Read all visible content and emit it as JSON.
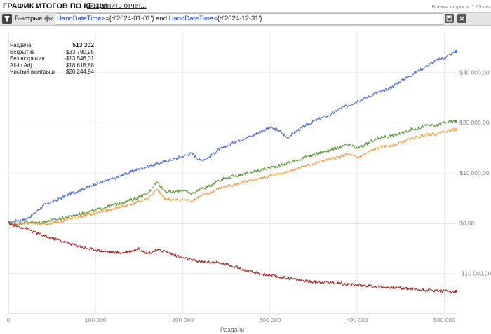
{
  "header": {
    "title": "ГРАФИК ИТОГОВ ПО КЕШУ",
    "save_link": "Сохранить отчет...",
    "request_time": "Время запроса: 1.05 сек"
  },
  "filter_bar": {
    "label": "Быстрые фильтры",
    "query": {
      "field1": "HandDateTime",
      "op1": ">={d'2024-01-01'} and ",
      "field2": "HandDateTime",
      "op2": "<{d'2024-12-31'}"
    },
    "icons": [
      "filter-icon",
      "save-icon",
      "close-icon"
    ]
  },
  "stats": [
    {
      "label": "Раздача:",
      "value": "513 302"
    },
    {
      "label": "Вскрытие",
      "value": "$33 790,95"
    },
    {
      "label": "Без вскрытия",
      "value": "-$13 546,01"
    },
    {
      "label": "All-in Adj",
      "value": "$18 618,88"
    },
    {
      "label": "Чистый выигрыш",
      "value": "$20 244,94"
    }
  ],
  "chart_data": {
    "type": "line",
    "xlabel": "Раздачи",
    "xlim": [
      0,
      513302
    ],
    "ylim": [
      -18000,
      38000
    ],
    "x_ticks": [
      0,
      100000,
      200000,
      300000,
      400000,
      500000
    ],
    "x_tick_labels": [
      "0",
      "100 000",
      "200 000",
      "300 000",
      "400 000",
      "500 000"
    ],
    "y_ticks": [
      -10000,
      0,
      10000,
      20000,
      30000
    ],
    "y_tick_labels": [
      "-$10 000,00",
      "$0,00",
      "$10 000,00",
      "$20 000,00",
      "$30 000,00"
    ],
    "grid": true,
    "x": [
      0,
      10000,
      20000,
      30000,
      40000,
      50000,
      60000,
      70000,
      80000,
      90000,
      100000,
      110000,
      120000,
      130000,
      140000,
      150000,
      160000,
      170000,
      180000,
      190000,
      200000,
      210000,
      220000,
      230000,
      240000,
      250000,
      260000,
      270000,
      280000,
      290000,
      300000,
      310000,
      320000,
      330000,
      340000,
      350000,
      360000,
      370000,
      380000,
      390000,
      400000,
      410000,
      420000,
      430000,
      440000,
      450000,
      460000,
      470000,
      480000,
      490000,
      500000,
      513302
    ],
    "series": [
      {
        "color": "#4f72e0",
        "values": [
          0,
          500,
          700,
          2000,
          3500,
          4200,
          5000,
          5800,
          6400,
          7100,
          7800,
          8300,
          8800,
          9500,
          10200,
          10800,
          11300,
          11800,
          12300,
          12800,
          13300,
          13900,
          12500,
          13100,
          14500,
          15300,
          16200,
          16800,
          17400,
          18300,
          19000,
          18500,
          17000,
          18300,
          19300,
          20300,
          21000,
          21600,
          22800,
          23400,
          24300,
          24900,
          25800,
          26300,
          27100,
          28300,
          29300,
          30300,
          31300,
          32300,
          32900,
          34200
        ]
      },
      {
        "color": "#5d9a3b",
        "values": [
          0,
          -200,
          300,
          100,
          200,
          600,
          900,
          1300,
          1800,
          2200,
          2600,
          3100,
          3600,
          4100,
          4600,
          5200,
          5900,
          8300,
          6300,
          6200,
          6600,
          5800,
          6800,
          7300,
          8500,
          9000,
          9400,
          9800,
          10200,
          10600,
          11100,
          11400,
          12000,
          12500,
          13100,
          13600,
          14100,
          14600,
          15100,
          15600,
          14900,
          15700,
          16600,
          17200,
          17400,
          17800,
          18600,
          18900,
          19500,
          19300,
          20100,
          20244
        ]
      },
      {
        "color": "#f5a04a",
        "values": [
          0,
          -300,
          100,
          -100,
          -300,
          0,
          400,
          800,
          1200,
          1600,
          2000,
          2400,
          2800,
          3300,
          3800,
          4300,
          4900,
          6700,
          4900,
          4600,
          4700,
          4400,
          5400,
          5900,
          6800,
          7300,
          7700,
          8100,
          8500,
          9000,
          9400,
          9800,
          10300,
          10800,
          11400,
          11800,
          12300,
          12800,
          13200,
          13700,
          13000,
          13800,
          14700,
          15300,
          15500,
          16000,
          16800,
          17100,
          17800,
          17700,
          18300,
          18618
        ]
      },
      {
        "color": "#a52d2b",
        "values": [
          0,
          -600,
          -1000,
          -1800,
          -2500,
          -3000,
          -3500,
          -4000,
          -4500,
          -5000,
          -5300,
          -5600,
          -5800,
          -5900,
          -5500,
          -5100,
          -6000,
          -5400,
          -5600,
          -6300,
          -6900,
          -7300,
          -7700,
          -7700,
          -7900,
          -8200,
          -8600,
          -9300,
          -9800,
          -10100,
          -10400,
          -10700,
          -10900,
          -11200,
          -11500,
          -11700,
          -11700,
          -11800,
          -11900,
          -12200,
          -12300,
          -12400,
          -12600,
          -12700,
          -12800,
          -12900,
          -13000,
          -13200,
          -13300,
          -13400,
          -13500,
          -13546
        ]
      }
    ]
  }
}
